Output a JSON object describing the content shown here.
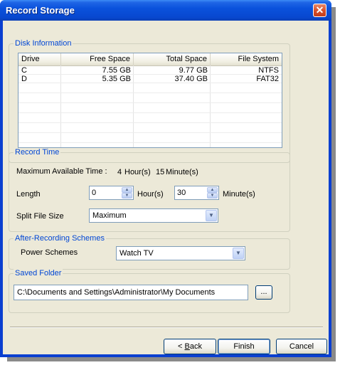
{
  "window": {
    "title": "Record Storage",
    "close_glyph": "✕"
  },
  "disk_info": {
    "legend": "Disk Information",
    "columns": [
      "Drive",
      "Free Space",
      "Total Space",
      "File System"
    ],
    "rows": [
      [
        "C",
        "7.55 GB",
        "9.77 GB",
        "NTFS"
      ],
      [
        "D",
        "5.35 GB",
        "37.40 GB",
        "FAT32"
      ]
    ]
  },
  "record_time": {
    "legend": "Record Time",
    "max_label": "Maximum Available Time :",
    "max_hours": "4",
    "hour_unit": "Hour(s)",
    "max_minutes": "15",
    "minute_unit": "Minute(s)",
    "length_label": "Length",
    "hours_value": "0",
    "hours_suffix": "Hour(s)",
    "minutes_value": "30",
    "minutes_suffix": "Minute(s)",
    "split_label": "Split File Size",
    "split_value": "Maximum"
  },
  "after_recording": {
    "legend": "After-Recording Schemes",
    "power_label": "Power Schemes",
    "power_value": "Watch TV"
  },
  "saved_folder": {
    "legend": "Saved Folder",
    "path": "C:\\Documents and Settings\\Administrator\\My Documents",
    "browse_label": "..."
  },
  "buttons": {
    "back_prefix": "< ",
    "back_mnemonic": "B",
    "back_rest": "ack",
    "finish": "Finish",
    "cancel": "Cancel"
  },
  "icons": {
    "spin_up": "▲",
    "spin_down": "▼",
    "dropdown": "▼"
  },
  "colors": {
    "titlebar": "#0a52dc",
    "dialog_bg": "#ece9d8",
    "group_legend": "#0046d5",
    "close_button": "#d8512c"
  }
}
